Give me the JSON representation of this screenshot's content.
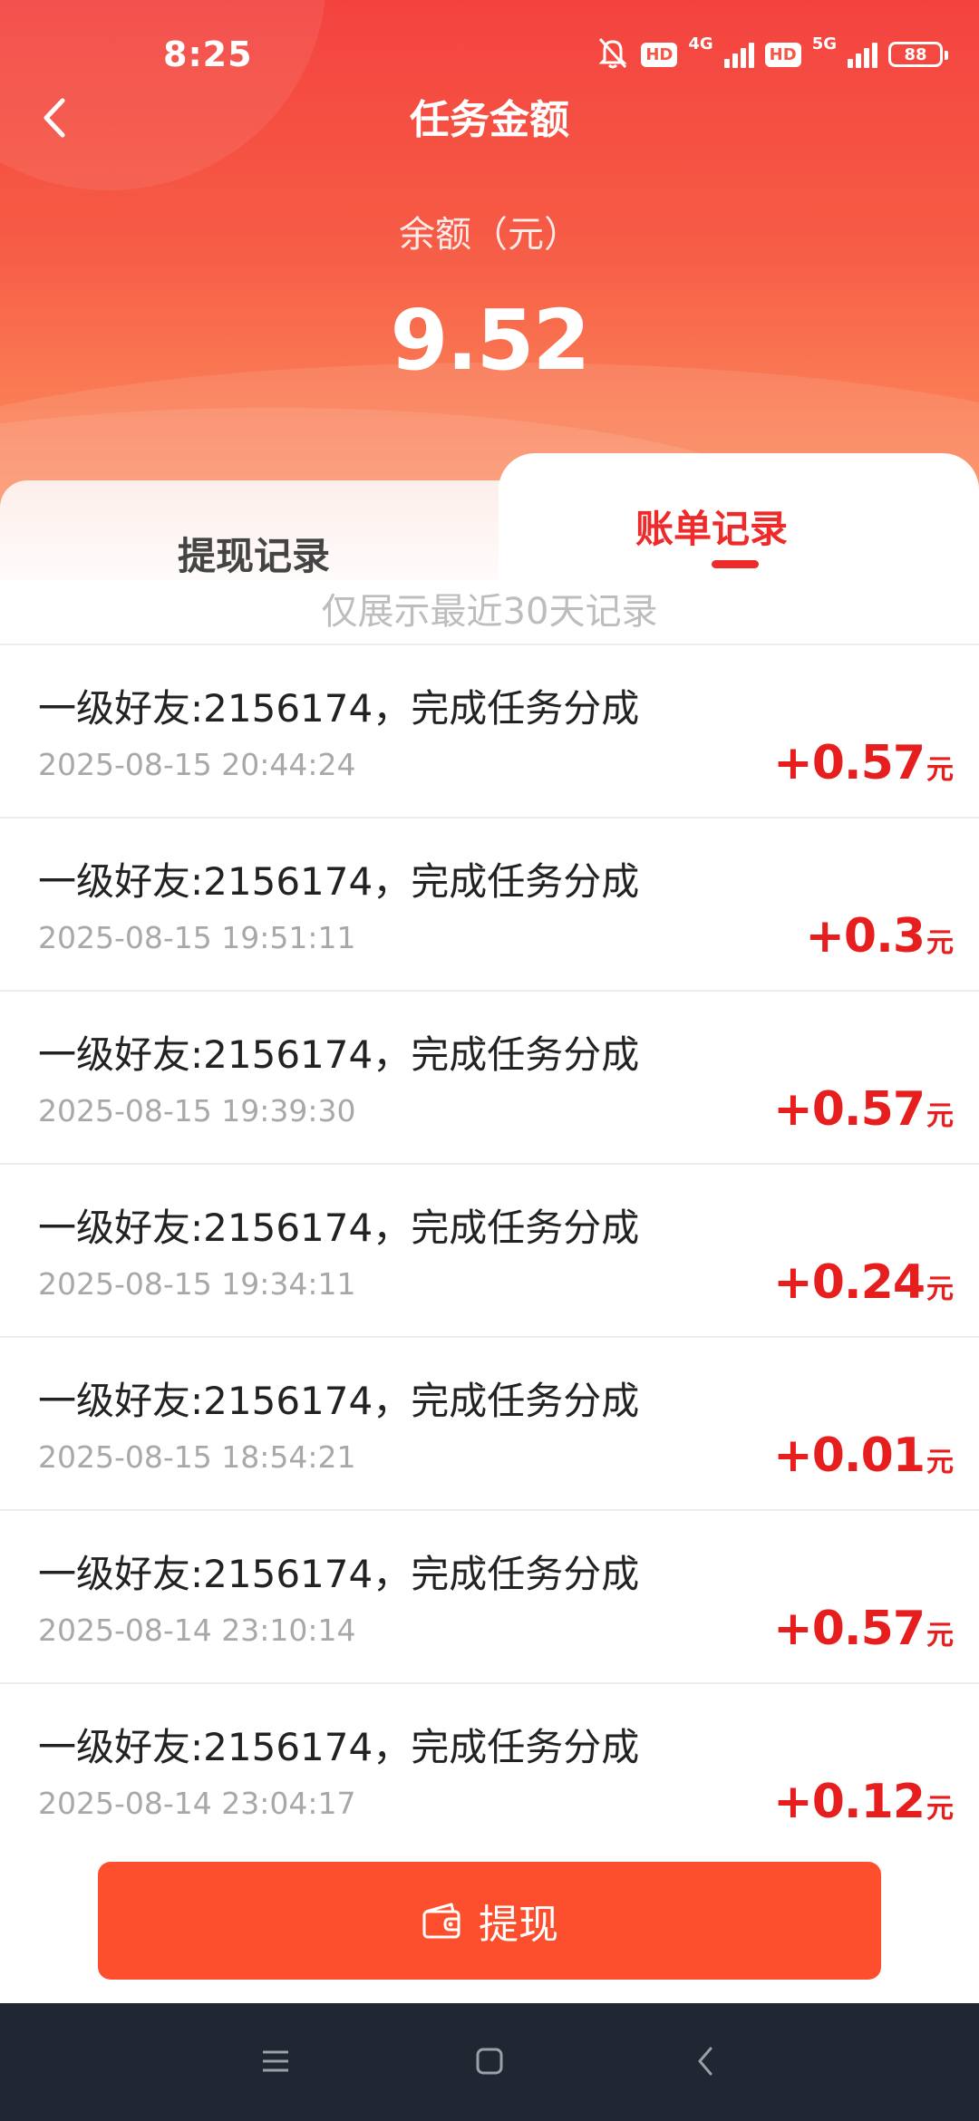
{
  "status_bar": {
    "time": "8:25",
    "hd1": "HD",
    "net1": "4G",
    "hd2": "HD",
    "net2": "5G",
    "battery": "88"
  },
  "header": {
    "title": "任务金额",
    "balance_label": "余额（元）",
    "balance_value": "9.52"
  },
  "tabs": [
    {
      "label": "提现记录",
      "active": false
    },
    {
      "label": "账单记录",
      "active": true
    }
  ],
  "hint": "仅展示最近30天记录",
  "records": [
    {
      "title": "一级好友:2156174，完成任务分成",
      "time": "2025-08-15 20:44:24",
      "amount": "+0.57",
      "unit": "元"
    },
    {
      "title": "一级好友:2156174，完成任务分成",
      "time": "2025-08-15 19:51:11",
      "amount": "+0.3",
      "unit": "元"
    },
    {
      "title": "一级好友:2156174，完成任务分成",
      "time": "2025-08-15 19:39:30",
      "amount": "+0.57",
      "unit": "元"
    },
    {
      "title": "一级好友:2156174，完成任务分成",
      "time": "2025-08-15 19:34:11",
      "amount": "+0.24",
      "unit": "元"
    },
    {
      "title": "一级好友:2156174，完成任务分成",
      "time": "2025-08-15 18:54:21",
      "amount": "+0.01",
      "unit": "元"
    },
    {
      "title": "一级好友:2156174，完成任务分成",
      "time": "2025-08-14 23:10:14",
      "amount": "+0.57",
      "unit": "元"
    },
    {
      "title": "一级好友:2156174，完成任务分成",
      "time": "2025-08-14 23:04:17",
      "amount": "+0.12",
      "unit": "元"
    }
  ],
  "withdraw_button": {
    "label": "提现",
    "icon": "wallet-icon"
  },
  "colors": {
    "header_red": "#f4433f",
    "accent_red": "#e61e1e",
    "button_orange": "#fd4f2e",
    "navbar_bg": "#202632"
  }
}
